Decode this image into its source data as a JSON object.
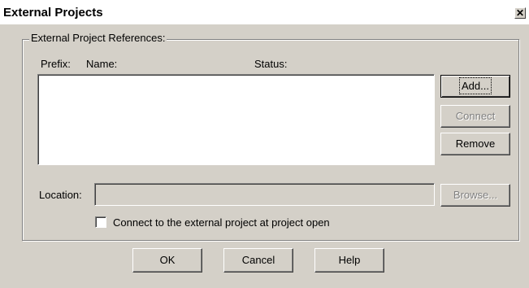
{
  "window": {
    "title": "External Projects",
    "close_glyph": "✕"
  },
  "group": {
    "legend": "External Project References:",
    "col_prefix": "Prefix:",
    "col_name": "Name:",
    "col_status": "Status:"
  },
  "buttons": {
    "add": "Add...",
    "connect": "Connect",
    "remove": "Remove",
    "browse": "Browse...",
    "ok": "OK",
    "cancel": "Cancel",
    "help": "Help"
  },
  "location": {
    "label": "Location:",
    "value": ""
  },
  "checkbox": {
    "label": "Connect to the external project at project open",
    "checked": false
  }
}
